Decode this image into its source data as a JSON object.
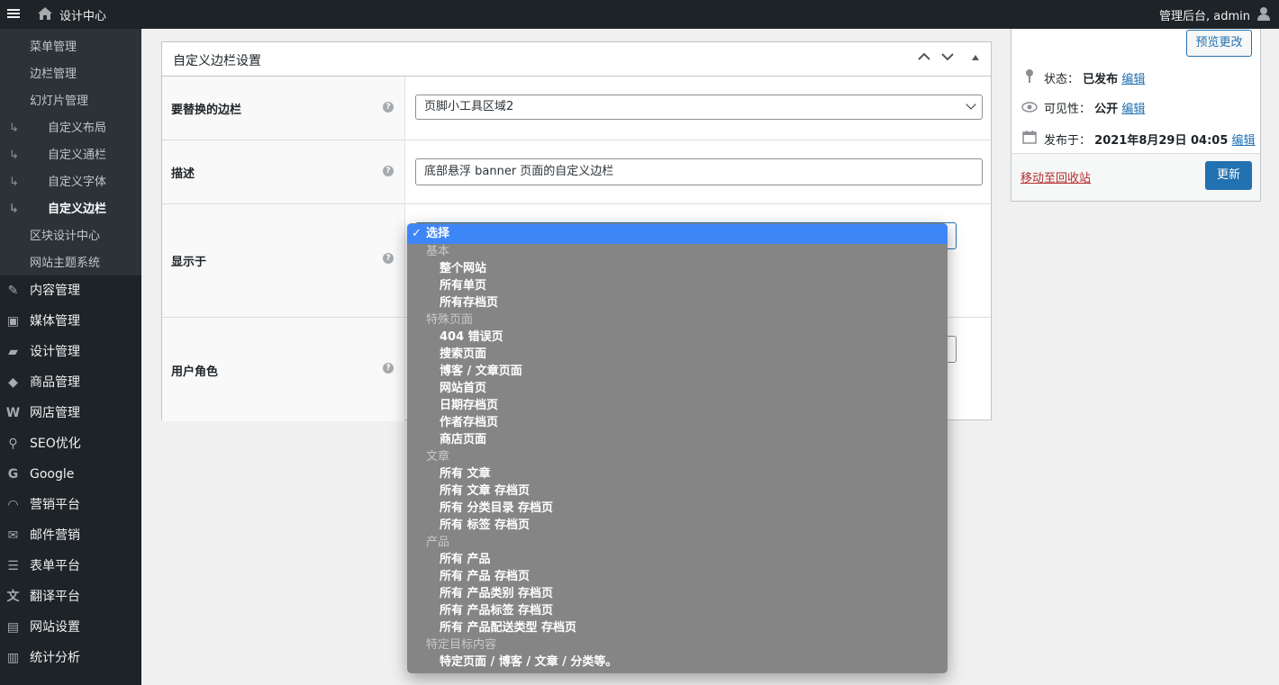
{
  "adminbar": {
    "site_name": "设计中心",
    "account": "管理后台, admin"
  },
  "sidebar": {
    "submenu": [
      {
        "label": "菜单管理",
        "child": false,
        "current": false
      },
      {
        "label": "边栏管理",
        "child": false,
        "current": false
      },
      {
        "label": "幻灯片管理",
        "child": false,
        "current": false
      },
      {
        "label": "自定义布局",
        "child": true,
        "current": false
      },
      {
        "label": "自定义通栏",
        "child": true,
        "current": false
      },
      {
        "label": "自定义字体",
        "child": true,
        "current": false
      },
      {
        "label": "自定义边栏",
        "child": true,
        "current": true
      },
      {
        "label": "区块设计中心",
        "child": false,
        "current": false
      },
      {
        "label": "网站主题系统",
        "child": false,
        "current": false
      }
    ],
    "child_arrow": "↳",
    "main": [
      {
        "label": "内容管理",
        "icon": "pencil-icon",
        "glyph": "✎"
      },
      {
        "label": "媒体管理",
        "icon": "media-icon",
        "glyph": "▣"
      },
      {
        "label": "设计管理",
        "icon": "folder-icon",
        "glyph": "▰"
      },
      {
        "label": "商品管理",
        "icon": "box-icon",
        "glyph": "◆"
      },
      {
        "label": "网店管理",
        "icon": "woo-icon",
        "glyph": "W"
      },
      {
        "label": "SEO优化",
        "icon": "search-icon",
        "glyph": "⚲"
      },
      {
        "label": "Google",
        "icon": "google-icon",
        "glyph": "G"
      },
      {
        "label": "营销平台",
        "icon": "rss-icon",
        "glyph": "◠"
      },
      {
        "label": "邮件营销",
        "icon": "mail-icon",
        "glyph": "✉"
      },
      {
        "label": "表单平台",
        "icon": "form-icon",
        "glyph": "☰"
      },
      {
        "label": "翻译平台",
        "icon": "translate-icon",
        "glyph": "文"
      },
      {
        "label": "网站设置",
        "icon": "settings-icon",
        "glyph": "▤"
      },
      {
        "label": "统计分析",
        "icon": "chart-icon",
        "glyph": "▥"
      }
    ]
  },
  "metabox": {
    "title": "自定义边栏设置",
    "rows": {
      "replace_label": "要替换的边栏",
      "replace_value": "页脚小工具区域2",
      "desc_label": "描述",
      "desc_value": "底部悬浮 banner 页面的自定义边栏",
      "display_label": "显示于",
      "role_label": "用户角色"
    }
  },
  "publish": {
    "preview_label": "预览更改",
    "status_label": "状态：",
    "status_value": "已发布",
    "visibility_label": "可见性：",
    "visibility_value": "公开",
    "published_label": "发布于：",
    "published_value": "2021年8月29日 04:05",
    "edit_label": "编辑",
    "trash_label": "移动至回收站",
    "update_label": "更新"
  },
  "dropdown": {
    "selected": "选择",
    "check": "✓",
    "items": [
      {
        "type": "group",
        "label": "基本"
      },
      {
        "type": "option",
        "label": "整个网站"
      },
      {
        "type": "option",
        "label": "所有单页"
      },
      {
        "type": "option",
        "label": "所有存档页"
      },
      {
        "type": "group",
        "label": "特殊页面"
      },
      {
        "type": "option",
        "label": "404 错误页"
      },
      {
        "type": "option",
        "label": "搜索页面"
      },
      {
        "type": "option",
        "label": "博客 / 文章页面"
      },
      {
        "type": "option",
        "label": "网站首页"
      },
      {
        "type": "option",
        "label": "日期存档页"
      },
      {
        "type": "option",
        "label": "作者存档页"
      },
      {
        "type": "option",
        "label": "商店页面"
      },
      {
        "type": "group",
        "label": "文章"
      },
      {
        "type": "option",
        "label": "所有 文章"
      },
      {
        "type": "option",
        "label": "所有 文章 存档页"
      },
      {
        "type": "option",
        "label": "所有 分类目录 存档页"
      },
      {
        "type": "option",
        "label": "所有 标签 存档页"
      },
      {
        "type": "group",
        "label": "产品"
      },
      {
        "type": "option",
        "label": "所有 产品"
      },
      {
        "type": "option",
        "label": "所有 产品 存档页"
      },
      {
        "type": "option",
        "label": "所有 产品类别 存档页"
      },
      {
        "type": "option",
        "label": "所有 产品标签 存档页"
      },
      {
        "type": "option",
        "label": "所有 产品配送类型 存档页"
      },
      {
        "type": "group",
        "label": "特定目标内容"
      },
      {
        "type": "option",
        "label": "特定页面 / 博客 / 文章 / 分类等。"
      }
    ]
  }
}
